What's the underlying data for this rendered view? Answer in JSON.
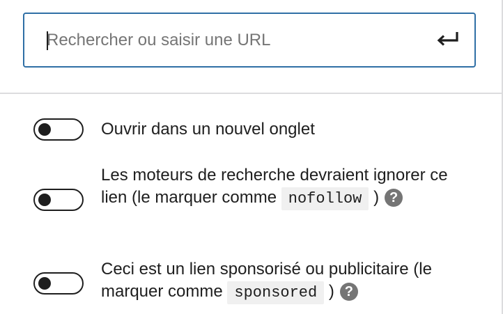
{
  "search": {
    "placeholder": "Rechercher ou saisir une URL",
    "submit_icon": "enter-arrow-icon"
  },
  "settings": [
    {
      "label": "Ouvrir dans un nouvel onglet",
      "checked": false
    },
    {
      "label_prefix": "Les moteurs de recherche devraient ignorer ce lien (le marquer comme",
      "code": "nofollow",
      "label_suffix": ")",
      "help_icon": "?",
      "checked": false
    },
    {
      "label_prefix": "Ceci est un lien sponsorisé ou publicitaire (le marquer comme",
      "code": "sponsored",
      "label_suffix": ")",
      "help_icon": "?",
      "checked": false
    }
  ],
  "colors": {
    "focus_border": "#2f6fa5",
    "text": "#1e1e1e",
    "divider": "#dcdcde",
    "help_icon_bg": "#757575"
  }
}
